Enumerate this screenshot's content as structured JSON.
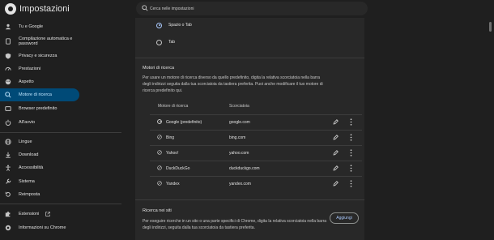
{
  "header": {
    "title": "Impostazioni",
    "search_placeholder": "Cerca nelle impostazioni"
  },
  "sidebar": {
    "items": [
      {
        "label": "Tu e Google",
        "icon": "person-icon"
      },
      {
        "label": "Compilazione automatica e password",
        "icon": "clipboard-icon"
      },
      {
        "label": "Privacy e sicurezza",
        "icon": "shield-icon"
      },
      {
        "label": "Prestazioni",
        "icon": "speedometer-icon"
      },
      {
        "label": "Aspetto",
        "icon": "palette-icon"
      },
      {
        "label": "Motore di ricerca",
        "icon": "search-icon",
        "active": true
      },
      {
        "label": "Browser predefinito",
        "icon": "browser-icon"
      },
      {
        "label": "All'avvio",
        "icon": "power-icon"
      },
      {
        "label": "Lingue",
        "icon": "globe-icon"
      },
      {
        "label": "Download",
        "icon": "download-icon"
      },
      {
        "label": "Accessibilità",
        "icon": "accessibility-icon"
      },
      {
        "label": "Sistema",
        "icon": "wrench-icon"
      },
      {
        "label": "Reimposta",
        "icon": "reset-icon"
      },
      {
        "label": "Estensioni",
        "icon": "puzzle-icon"
      },
      {
        "label": "Informazioni su Chrome",
        "icon": "chrome-icon"
      }
    ]
  },
  "main": {
    "radio_options": [
      {
        "label": "Spazio o Tab",
        "checked": true
      },
      {
        "label": "Tab",
        "checked": false
      }
    ],
    "search_engines": {
      "title": "Motori di ricerca",
      "description": "Per usare un motore di ricerca diverso da quello predefinito, digita la relativa scorciatoia nella barra degli indirizzi seguita dalla tua scorciatoia da tastiera preferita. Puoi anche modificare il tuo motore di ricerca predefinito qui.",
      "col_engine": "Motore di ricerca",
      "col_shortcut": "Scorciatoia",
      "rows": [
        {
          "name": "Google (predefinito)",
          "shortcut": "google.com",
          "icon": "google-icon"
        },
        {
          "name": "Bing",
          "shortcut": "bing.com",
          "icon": "globe-icon"
        },
        {
          "name": "Yahoo!",
          "shortcut": "yahoo.com",
          "icon": "globe-icon"
        },
        {
          "name": "DuckDuckGo",
          "shortcut": "duckduckgo.com",
          "icon": "globe-icon"
        },
        {
          "name": "Yandex",
          "shortcut": "yandex.com",
          "icon": "globe-icon"
        }
      ]
    },
    "site_search": {
      "title": "Ricerca nei siti",
      "description": "Per eseguire ricerche in un sito o una parte specifici di Chrome, digita la relativa scorciatoia nella barra degli indirizzi, seguita dalla tua scorciatoia da tastiera preferita.",
      "add_label": "Aggiungi"
    }
  },
  "colors": {
    "background": "#1f1f1f",
    "card": "#282828",
    "active_nav": "#004a77",
    "accent": "#a8c7fa"
  }
}
